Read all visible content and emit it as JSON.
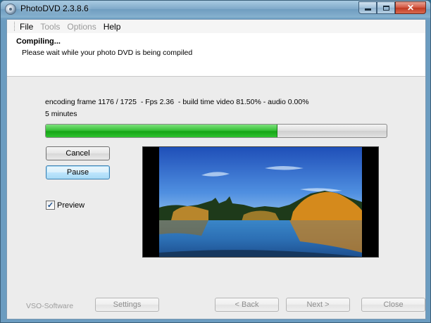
{
  "window": {
    "title": "PhotoDVD 2.3.8.6",
    "app_icon": "dvd-disc-icon",
    "controls": {
      "minimize_icon": "minimize-icon",
      "maximize_icon": "maximize-icon",
      "close_glyph": "✕"
    }
  },
  "menu": {
    "items": [
      {
        "label": "File",
        "enabled": true
      },
      {
        "label": "Tools",
        "enabled": false
      },
      {
        "label": "Options",
        "enabled": false
      },
      {
        "label": "Help",
        "enabled": true
      }
    ]
  },
  "header": {
    "title": "Compiling...",
    "subtitle": "Please wait while your photo DVD is being compiled"
  },
  "progress": {
    "status_text": "encoding frame 1176 / 1725  - Fps 2.36  - build time video 81.50% - audio 0.00%",
    "time_remaining": "5 minutes",
    "fraction": 0.68,
    "fill_color": "#22b022"
  },
  "actions": {
    "cancel_label": "Cancel",
    "pause_label": "Pause"
  },
  "preview_toggle": {
    "label": "Preview",
    "checked": true,
    "check_glyph": "✓"
  },
  "footer": {
    "brand": "VSO-Software",
    "settings_label": "Settings",
    "back_label": "< Back",
    "next_label": "Next >",
    "close_label": "Close"
  },
  "colors": {
    "title_bar": "#7fa9c9",
    "client_bg": "#ececec",
    "accent": "#3c7fb1"
  }
}
